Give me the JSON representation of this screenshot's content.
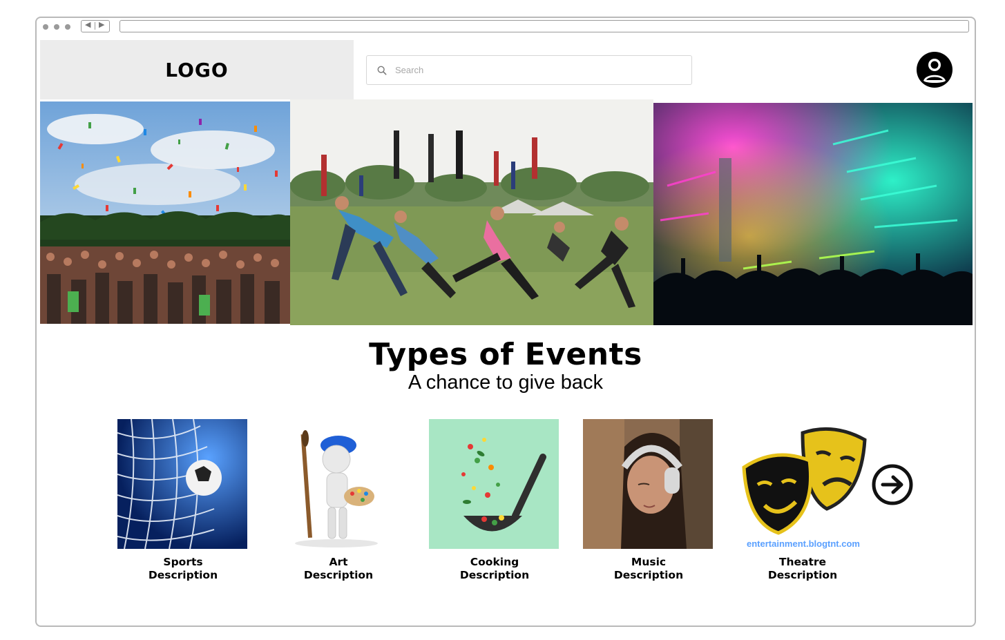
{
  "header": {
    "logo_text": "LOGO",
    "search_placeholder": "Search",
    "search_icon": "search-icon",
    "profile_icon": "user-circle-icon"
  },
  "hero": {
    "images": [
      {
        "name": "confetti-crowd-image"
      },
      {
        "name": "outdoor-stretching-image"
      },
      {
        "name": "concert-lights-image"
      }
    ]
  },
  "section": {
    "title": "Types of Events",
    "subtitle": "A chance to give back"
  },
  "categories": [
    {
      "name": "Sports",
      "description": "Description"
    },
    {
      "name": "Art",
      "description": "Description"
    },
    {
      "name": "Cooking",
      "description": "Description"
    },
    {
      "name": "Music",
      "description": "Description"
    },
    {
      "name": "Theatre",
      "description": "Description",
      "image_caption": "entertainment.blogtnt.com"
    }
  ],
  "controls": {
    "next_icon": "arrow-right-circle-icon"
  },
  "colors": {
    "logo_bg": "#ececec",
    "accent_mask": "#e6c21b",
    "cooking_bg": "#a8e6c4",
    "sports_bg": "#0b2a6e"
  }
}
